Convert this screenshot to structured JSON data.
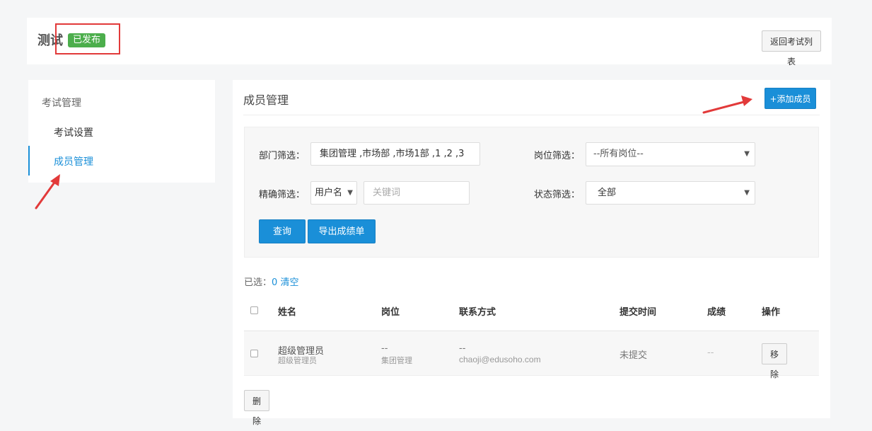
{
  "header": {
    "title": "测试",
    "status_badge": "已发布",
    "back_button": "返回考试列表"
  },
  "sidebar": {
    "group_label": "考试管理",
    "items": [
      {
        "label": "考试设置",
        "active": false
      },
      {
        "label": "成员管理",
        "active": true
      }
    ]
  },
  "main": {
    "title": "成员管理",
    "add_button": "+添加成员",
    "filters": {
      "dept_label": "部门筛选：",
      "dept_value": "集团管理 ,市场部 ,市场1部 ,1 ,2 ,3",
      "post_label": "岗位筛选：",
      "post_value": "--所有岗位--",
      "exact_label": "精确筛选：",
      "exact_field": "用户名",
      "keyword_placeholder": "关键词",
      "status_label": "状态筛选：",
      "status_value": "全部",
      "query_button": "查询",
      "export_button": "导出成绩单"
    },
    "selection": {
      "label": "已选：",
      "count": "0",
      "clear": "清空"
    },
    "table": {
      "headers": [
        "姓名",
        "岗位",
        "联系方式",
        "提交时间",
        "成绩",
        "操作"
      ],
      "rows": [
        {
          "name": "超级管理员",
          "name_sub": "超级管理员",
          "post": "--",
          "post_sub": "集团管理",
          "contact": "--",
          "contact_sub": "chaoji@edusoho.com",
          "submit_time": "未提交",
          "score": "--",
          "action": "移除"
        }
      ]
    },
    "delete_button": "删除"
  },
  "colors": {
    "primary": "#1a8fd8",
    "badge": "#4cae4c",
    "annotation": "#e23a3a"
  }
}
